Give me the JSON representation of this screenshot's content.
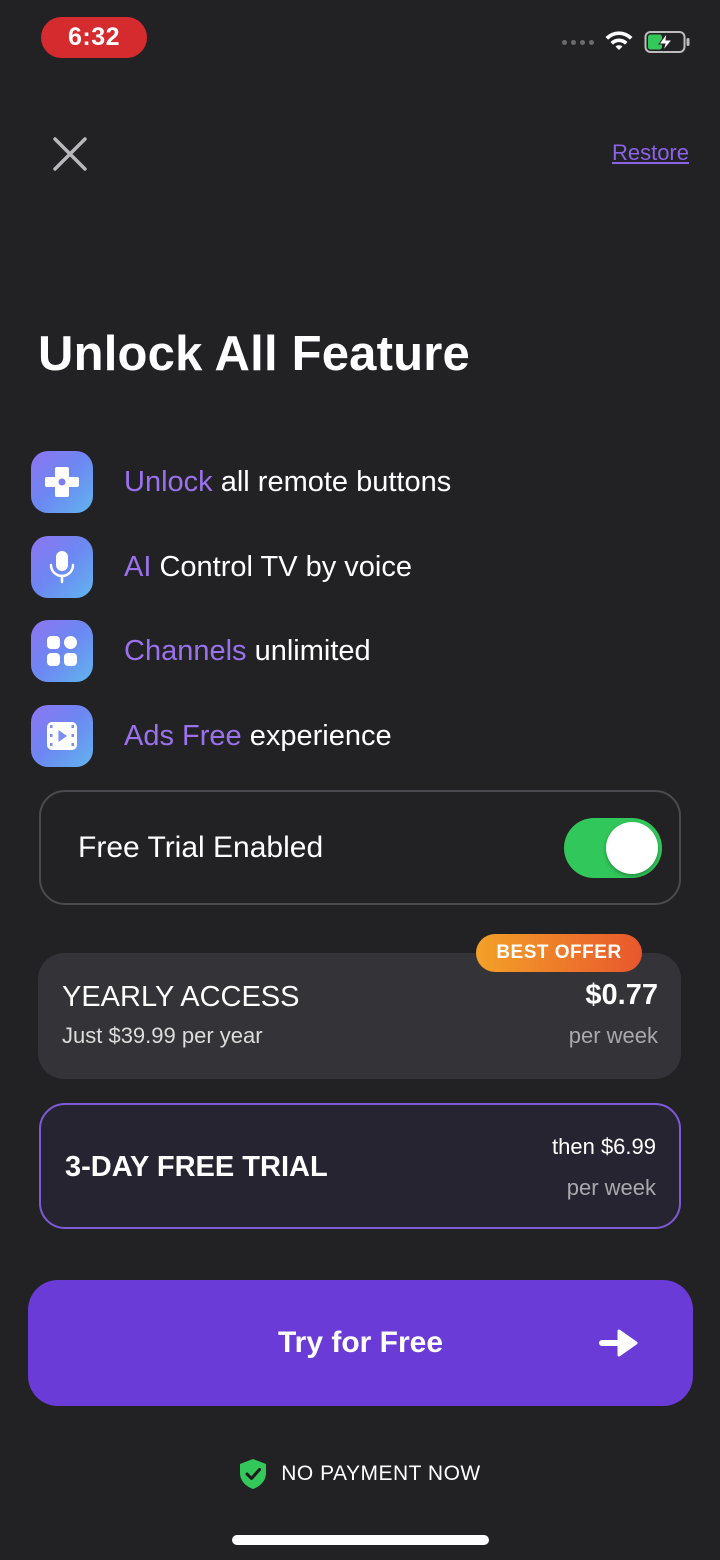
{
  "status_bar": {
    "time": "6:32"
  },
  "header": {
    "restore_label": "Restore"
  },
  "title": "Unlock All Feature",
  "features": [
    {
      "highlight": "Unlock",
      "text": " all remote buttons",
      "icon": "gamepad-icon"
    },
    {
      "highlight": "AI",
      "text": " Control TV by voice",
      "icon": "microphone-icon"
    },
    {
      "highlight": "Channels",
      "text": " unlimited",
      "icon": "grid-icon"
    },
    {
      "highlight": "Ads Free",
      "text": " experience",
      "icon": "video-icon"
    }
  ],
  "free_trial_toggle": {
    "label": "Free Trial Enabled",
    "enabled": true
  },
  "plans": {
    "yearly": {
      "badge": "BEST OFFER",
      "name": "YEARLY ACCESS",
      "subtitle": "Just $39.99 per year",
      "price": "$0.77",
      "unit": "per week"
    },
    "trial": {
      "name": "3-DAY FREE TRIAL",
      "then": "then $6.99",
      "unit": "per week"
    }
  },
  "cta": {
    "label": "Try for Free"
  },
  "footer": {
    "no_payment": "NO PAYMENT NOW"
  },
  "colors": {
    "background": "#222124",
    "accent": "#6a3bd6",
    "highlight_text": "#9a72ee",
    "toggle_on": "#32c75a",
    "status_time_bg": "#d52b2f"
  }
}
